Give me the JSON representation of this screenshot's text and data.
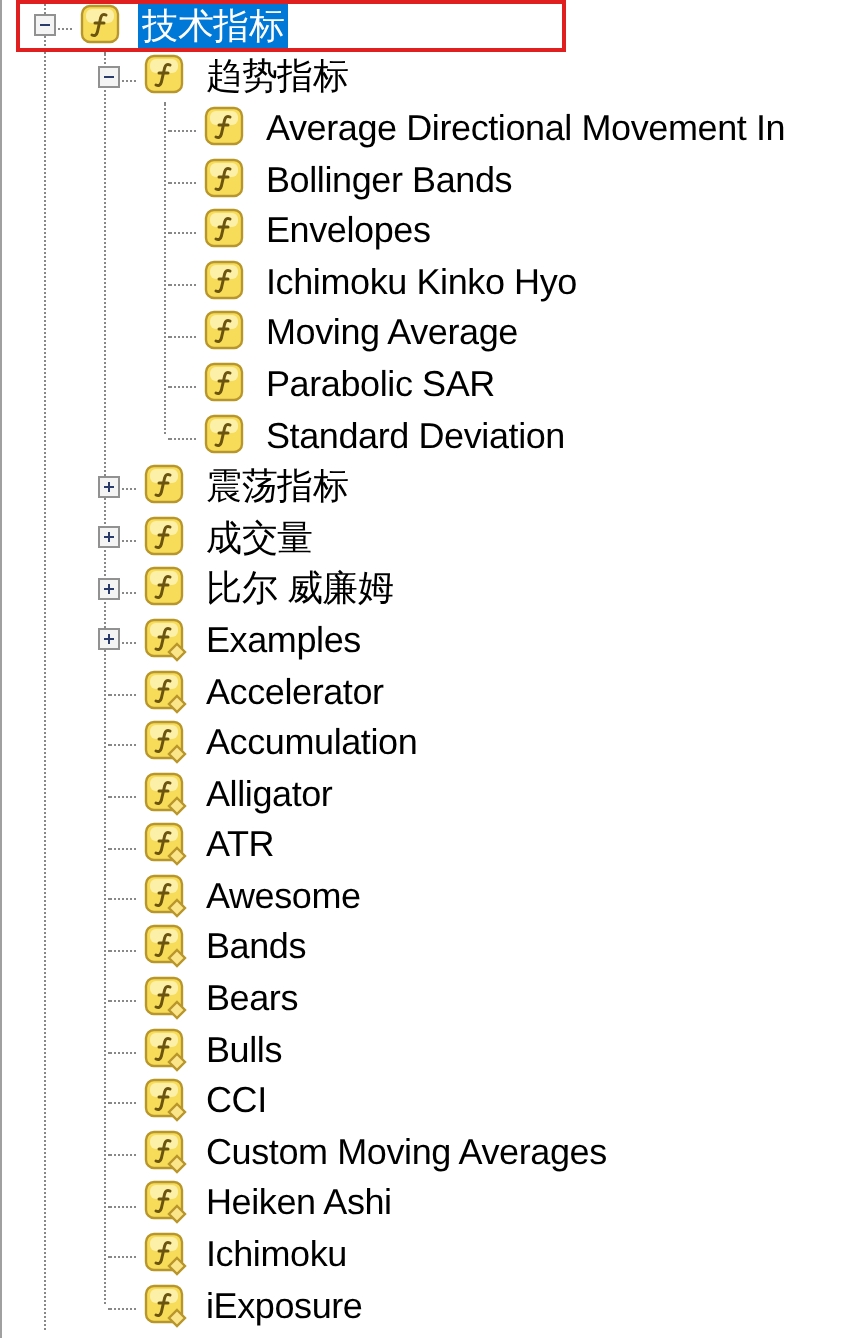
{
  "tree": [
    {
      "label": "技术指标",
      "kind": "builtin",
      "expanded": true,
      "selected": true,
      "outlined": true,
      "children": [
        {
          "label": "趋势指标",
          "kind": "builtin",
          "expanded": true,
          "selected": false,
          "children": [
            {
              "label": "Average Directional Movement In",
              "kind": "builtin",
              "selected": false,
              "outlined": false
            },
            {
              "label": "Bollinger Bands",
              "kind": "builtin",
              "selected": false,
              "outlined": false
            },
            {
              "label": "Envelopes",
              "kind": "builtin",
              "selected": false,
              "outlined": false
            },
            {
              "label": "Ichimoku Kinko Hyo",
              "kind": "builtin",
              "selected": false,
              "outlined": false
            },
            {
              "label": "Moving Average",
              "kind": "builtin",
              "selected": false,
              "outlined": false
            },
            {
              "label": "Parabolic SAR",
              "kind": "builtin",
              "selected": false,
              "outlined": false
            },
            {
              "label": "Standard Deviation",
              "kind": "builtin",
              "selected": false,
              "outlined": false
            }
          ]
        },
        {
          "label": "震荡指标",
          "kind": "builtin",
          "expanded": false,
          "selected": false
        },
        {
          "label": "成交量",
          "kind": "builtin",
          "expanded": false,
          "selected": false
        },
        {
          "label": "比尔 威廉姆",
          "kind": "builtin",
          "expanded": false,
          "selected": false
        },
        {
          "label": "Examples",
          "kind": "custom",
          "expanded": false,
          "selected": false
        },
        {
          "label": "Accelerator",
          "kind": "custom",
          "selected": false,
          "outlined": false
        },
        {
          "label": "Accumulation",
          "kind": "custom",
          "selected": false,
          "outlined": false
        },
        {
          "label": "Alligator",
          "kind": "custom",
          "selected": false,
          "outlined": false
        },
        {
          "label": "ATR",
          "kind": "custom",
          "selected": false,
          "outlined": false
        },
        {
          "label": "Awesome",
          "kind": "custom",
          "selected": false,
          "outlined": false
        },
        {
          "label": "Bands",
          "kind": "custom",
          "selected": false,
          "outlined": false
        },
        {
          "label": "Bears",
          "kind": "custom",
          "selected": false,
          "outlined": false
        },
        {
          "label": "Bulls",
          "kind": "custom",
          "selected": false,
          "outlined": false
        },
        {
          "label": "CCI",
          "kind": "custom",
          "selected": false,
          "outlined": false
        },
        {
          "label": "Custom Moving Averages",
          "kind": "custom",
          "selected": false,
          "outlined": false
        },
        {
          "label": "Heiken Ashi",
          "kind": "custom",
          "selected": false,
          "outlined": false
        },
        {
          "label": "Ichimoku",
          "kind": "custom",
          "selected": false,
          "outlined": false
        },
        {
          "label": "iExposure",
          "kind": "custom",
          "selected": false,
          "outlined": false
        }
      ]
    }
  ]
}
